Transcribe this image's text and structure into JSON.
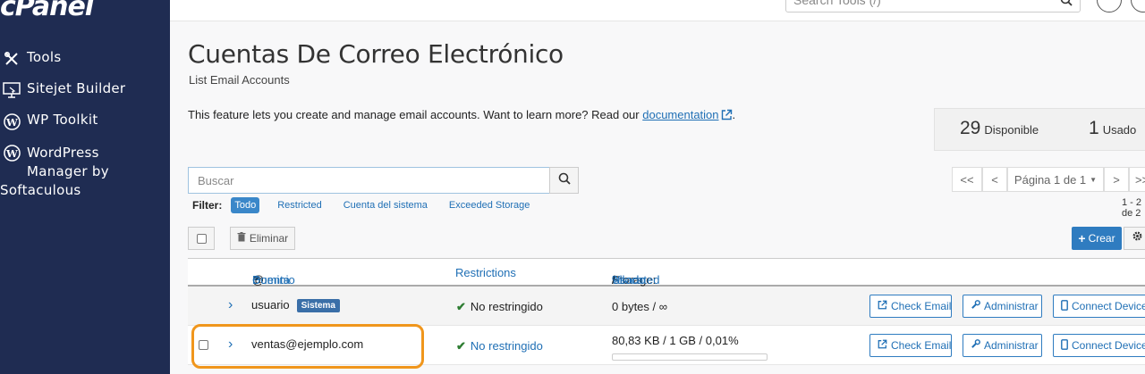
{
  "sidebar": {
    "logo": "cPanel",
    "items": [
      {
        "label": "Tools",
        "icon": "tools-icon"
      },
      {
        "label": "Sitejet Builder",
        "icon": "sitejet-icon"
      },
      {
        "label": "WP Toolkit",
        "icon": "wordpress-icon"
      },
      {
        "label_lines": [
          "WordPress",
          "Manager by",
          "Softaculous"
        ],
        "icon": "wordpress-icon"
      }
    ]
  },
  "topbar": {
    "search_placeholder": "Search Tools (/)"
  },
  "page": {
    "title": "Cuentas De Correo Electrónico",
    "subtitle": "List Email Accounts",
    "feature_text": "This feature lets you create and manage email accounts. Want to learn more? Read our ",
    "feature_link": "documentation",
    "feature_end": "."
  },
  "stats": {
    "available_num": "29",
    "available_label": "Disponible",
    "used_num": "1",
    "used_label": "Usado"
  },
  "search": {
    "placeholder": "Buscar"
  },
  "pager": {
    "first": "<<",
    "prev": "<",
    "page_label": "Página 1 de 1",
    "next": ">",
    "last": ">>",
    "range": "1 - 2 de 2"
  },
  "filter": {
    "label": "Filter:",
    "options": [
      "Todo",
      "Restricted",
      "Cuenta del sistema",
      "Exceeded Storage"
    ],
    "active": "Todo"
  },
  "toolbar": {
    "delete_label": "Eliminar",
    "create_label": "Crear"
  },
  "table": {
    "col_account": "Cuenta",
    "col_at": "@",
    "col_domain": "Dominio",
    "col_restrictions": "Restrictions",
    "col_storage_prefix": "Storage:",
    "col_used": "Usado",
    "col_slash": "/",
    "col_allocated": "Allocated",
    "col_pct": "%",
    "rows": [
      {
        "account": "usuario",
        "badge": "Sistema",
        "restriction": "No restringido",
        "storage": "0 bytes / ∞",
        "usage_fraction": 0
      },
      {
        "account": "ventas@ejemplo.com",
        "badge": "",
        "restriction": "No restringido",
        "storage": "80,83 KB / 1 GB / 0,01%",
        "usage_fraction": 0.0001
      }
    ],
    "actions": {
      "check": "Check Email",
      "admin": "Administrar",
      "connect": "Connect Devices"
    }
  },
  "colors": {
    "sidebar": "#1f2c52",
    "accent": "#2f7cc0",
    "highlight": "#f0961c",
    "success": "#2e7d32"
  }
}
